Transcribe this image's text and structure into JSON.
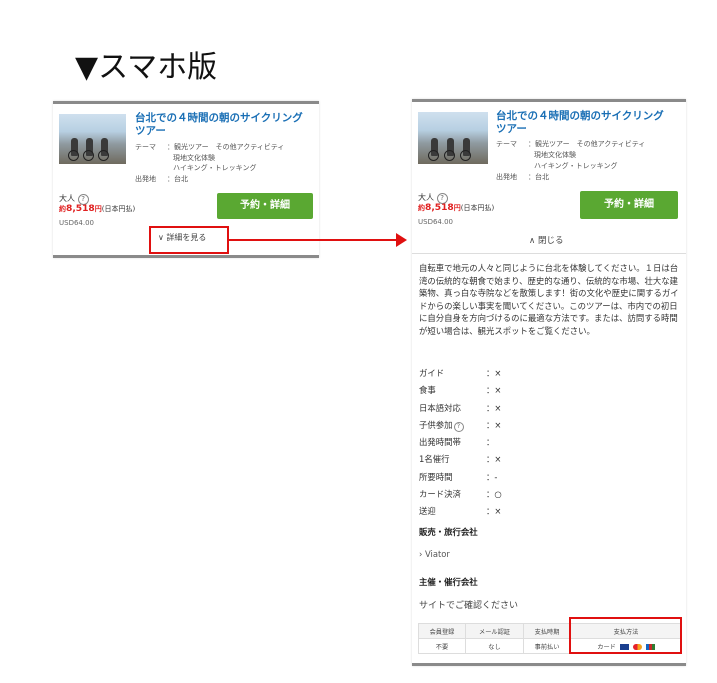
{
  "heading": "▼スマホ版",
  "tour": {
    "title_line1": "台北での４時間の朝のサイクリング",
    "title_line2": "ツアー",
    "theme_label": "テーマ",
    "theme_line1": "：観光ツアー　その他アクティビティ",
    "theme_line2": "現地文化体験",
    "theme_line3": "ハイキング・トレッキング",
    "departure_label": "出発地",
    "departure_value": "：台北",
    "adult_label": "大人",
    "help_glyph": "?",
    "price_prefix": "約",
    "price_value": "8,518",
    "price_unit": "円",
    "price_note": "(日本円払)",
    "usd": "USD64.00",
    "book_button": "予約・詳細",
    "expand_label": "詳細を見る",
    "collapse_label": "閉じる"
  },
  "details": {
    "description": "自転車で地元の人々と同じように台北を体験してください。１日は台湾の伝統的な朝食で始まり、歴史的な通り、伝統的な市場、壮大な建築物、真っ白な寺院などを散策します！街の文化や歴史に関するガイドからの楽しい事実を聞いてください。このツアーは、市内での初日に自分自身を方向づけるのに最適な方法です。または、訪問する時間が短い場合は、観光スポットをご覧ください。",
    "specs": [
      {
        "label": "ガイド",
        "value": "：×"
      },
      {
        "label": "食事",
        "value": "：×"
      },
      {
        "label": "日本語対応",
        "value": "：×"
      },
      {
        "label": "子供参加",
        "value": "：×"
      },
      {
        "label": "出発時間帯",
        "value": "："
      },
      {
        "label": "1名催行",
        "value": "：×"
      },
      {
        "label": "所要時間",
        "value": "：-"
      },
      {
        "label": "カード決済",
        "value": "：○"
      },
      {
        "label": "送迎",
        "value": "：×"
      }
    ],
    "seller_heading": "販売・旅行会社",
    "seller_name": "› Viator",
    "organizer_heading": "主催・催行会社",
    "organizer_note": "サイトでご確認ください",
    "payment_table": {
      "headers": [
        "会員登録",
        "メール認証",
        "支払時期",
        "支払方法"
      ],
      "values": [
        "不要",
        "なし",
        "事前払い",
        "カード"
      ]
    }
  },
  "colors": {
    "title_blue": "#1a6fb5",
    "price_red": "#e02020",
    "button_green": "#5aa832",
    "highlight_red": "#e01010"
  }
}
